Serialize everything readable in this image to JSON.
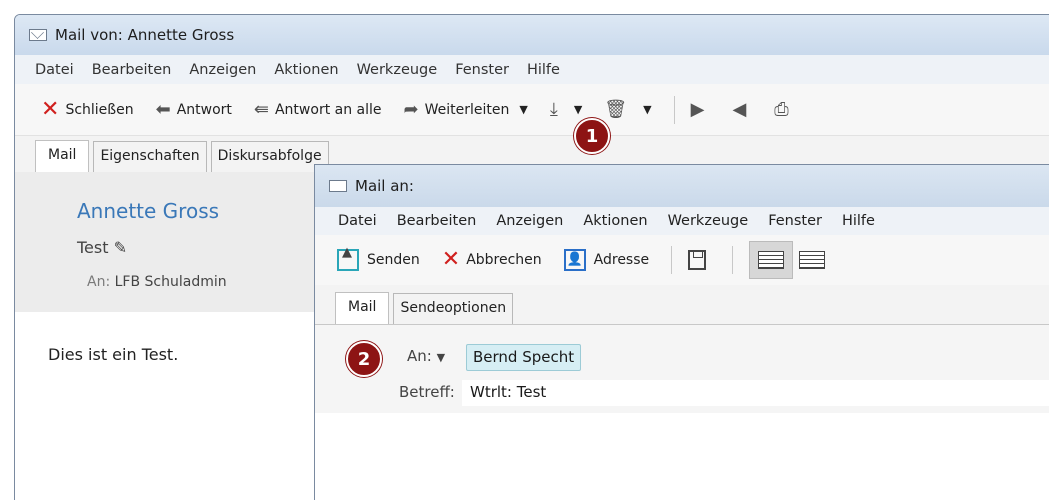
{
  "win1": {
    "title": "Mail von: Annette Gross",
    "menu": [
      "Datei",
      "Bearbeiten",
      "Anzeigen",
      "Aktionen",
      "Werkzeuge",
      "Fenster",
      "Hilfe"
    ],
    "toolbar": {
      "close": "Schließen",
      "reply": "Antwort",
      "reply_all": "Antwort an alle",
      "forward": "Weiterleiten"
    },
    "tabs": [
      "Mail",
      "Eigenschaften",
      "Diskursabfolge"
    ],
    "sender": "Annette Gross",
    "subject": "Test",
    "to_label": "An:",
    "to_value": "LFB Schuladmin",
    "body": "Dies ist ein Test."
  },
  "win2": {
    "title": "Mail an:",
    "menu": [
      "Datei",
      "Bearbeiten",
      "Anzeigen",
      "Aktionen",
      "Werkzeuge",
      "Fenster",
      "Hilfe"
    ],
    "toolbar": {
      "send": "Senden",
      "cancel": "Abbrechen",
      "address": "Adresse"
    },
    "tabs": [
      "Mail",
      "Sendeoptionen"
    ],
    "to_label": "An:",
    "recipient": "Bernd Specht",
    "subject_label": "Betreff:",
    "subject_value": "Wtrlt: Test"
  },
  "badges": [
    "1",
    "2"
  ],
  "colors": {
    "badge": "#8d1414",
    "sender": "#3a78b8",
    "close_x": "#d0201e"
  }
}
